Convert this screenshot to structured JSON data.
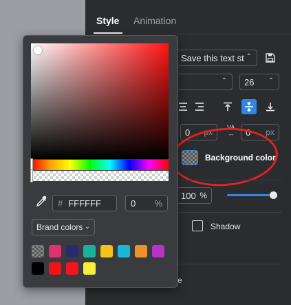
{
  "tabs": {
    "style": "Style",
    "animation": "Animation"
  },
  "text_style": {
    "value": "Save this text st",
    "icon": "save-icon"
  },
  "font_size": {
    "value": "26"
  },
  "spacing": {
    "letter": "0",
    "letter_unit": "px",
    "va_label": "VA",
    "line": "0",
    "line_unit": "px"
  },
  "background": {
    "label": "Background color"
  },
  "opacity": {
    "value": "100",
    "unit": "%",
    "level": 0.95
  },
  "shadow": {
    "label": "Shadow"
  },
  "partial_text": "e",
  "picker": {
    "hex_prefix": "#",
    "hex": "FFFFFF",
    "alpha": "0",
    "alpha_unit": "%",
    "brand_label": "Brand colors",
    "swatches": [
      {
        "color": "transparent",
        "name": "transparent"
      },
      {
        "color": "#e0306e"
      },
      {
        "color": "#2a2a6e"
      },
      {
        "color": "#17b39a"
      },
      {
        "color": "#f2c318"
      },
      {
        "color": "#1cb7d6"
      },
      {
        "color": "#f0902a"
      },
      {
        "color": "#b533c7"
      },
      {
        "color": "#000000"
      },
      {
        "color": "#f01414"
      },
      {
        "color": "#f5141e"
      },
      {
        "color": "#f8ef3a"
      }
    ]
  },
  "colors": {
    "accent": "#2f86e6",
    "annotation": "#e32222",
    "panel": "#2b2c2f"
  }
}
